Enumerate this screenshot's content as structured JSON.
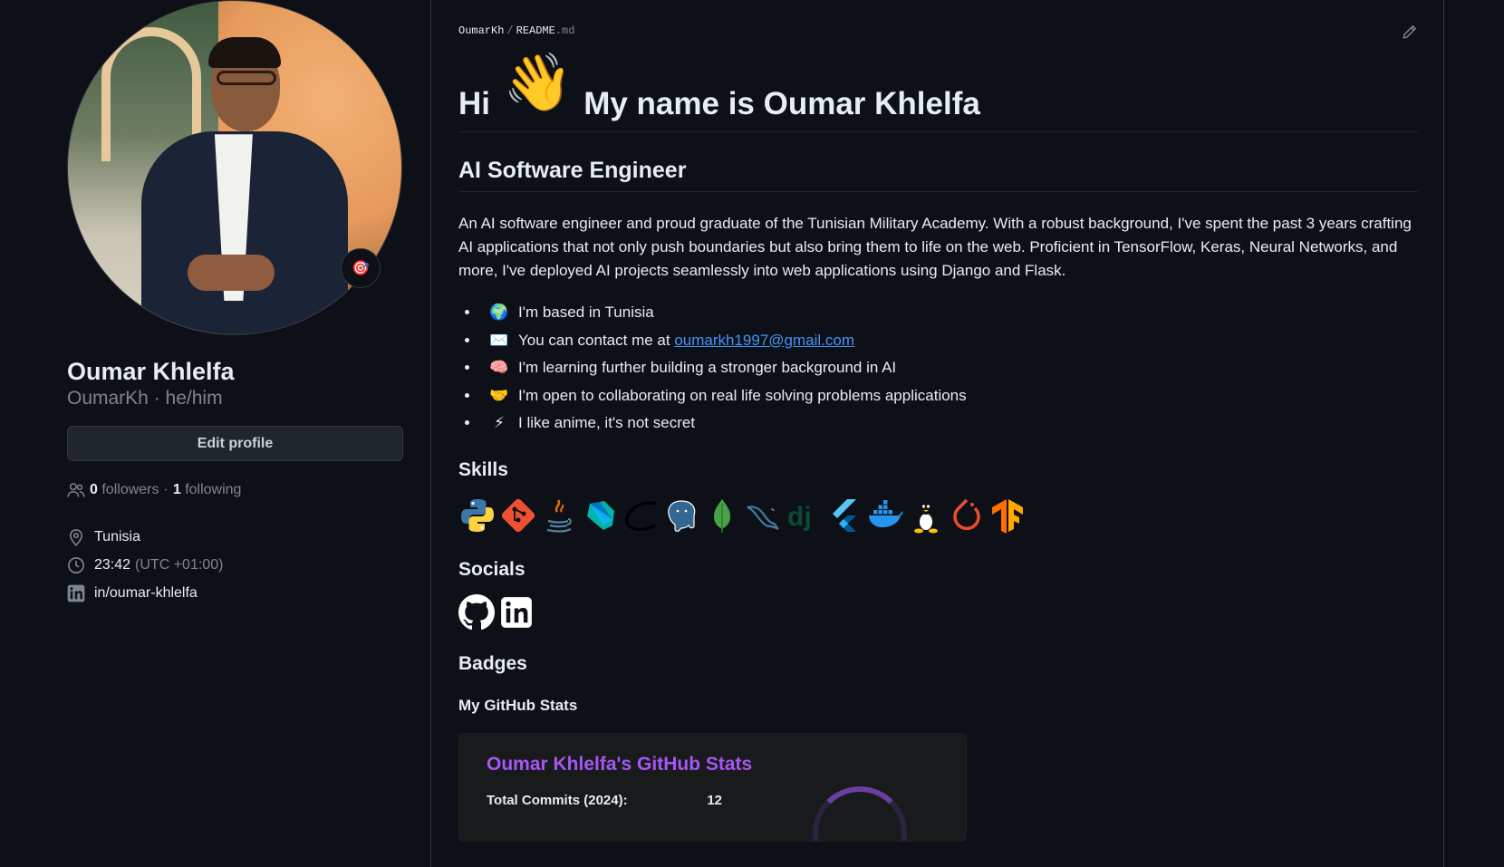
{
  "profile": {
    "name": "Oumar Khlelfa",
    "login_line": "OumarKh · he/him",
    "status_emoji": "🎯",
    "edit_label": "Edit profile",
    "followers_count": "0",
    "followers_label": "followers",
    "dot": "·",
    "following_count": "1",
    "following_label": "following",
    "location": "Tunisia",
    "time": "23:42",
    "timezone": "(UTC +01:00)",
    "linkedin": "in/oumar-khlelfa"
  },
  "readme": {
    "crumb_user": "OumarKh",
    "crumb_sep": "/",
    "crumb_file": "README",
    "crumb_ext": ".md",
    "h1_prefix": "Hi",
    "h1_emoji": "👋",
    "h1_suffix": "My name is Oumar Khlelfa",
    "h2": "AI Software Engineer",
    "intro": "An AI software engineer and proud graduate of the Tunisian Military Academy. With a robust background, I've spent the past 3 years crafting AI applications that not only push boundaries but also bring them to life on the web. Proficient in TensorFlow, Keras, Neural Networks, and more, I've deployed AI projects seamlessly into web applications using Django and Flask.",
    "bullets": [
      {
        "emoji": "🌍",
        "text": "I'm based in Tunisia"
      },
      {
        "emoji": "✉️",
        "text": "You can contact me at ",
        "link": "oumarkh1997@gmail.com"
      },
      {
        "emoji": "🧠",
        "text": "I'm learning further building a stronger background in AI"
      },
      {
        "emoji": "🤝",
        "text": "I'm open to collaborating on real life solving problems applications"
      },
      {
        "emoji": "⚡",
        "text": "I like anime, it's not secret"
      }
    ],
    "skills_heading": "Skills",
    "socials_heading": "Socials",
    "badges_heading": "Badges",
    "stats_subheading": "My GitHub Stats",
    "stats_title": "Oumar Khlelfa's GitHub Stats",
    "stats_row_label": "Total Commits (2024):",
    "stats_row_value": "12",
    "skills": [
      "python-icon",
      "git-icon",
      "java-icon",
      "dart-icon",
      "keras-icon",
      "postgresql-icon",
      "mongodb-icon",
      "mysql-icon",
      "django-icon",
      "flutter-icon",
      "docker-icon",
      "linux-icon",
      "pytorch-icon",
      "tensorflow-icon"
    ],
    "socials": [
      "github-icon",
      "linkedin-icon"
    ]
  },
  "colors": {
    "background": "#0d1117",
    "link": "#4493f8",
    "stats_title": "#a855f7"
  }
}
